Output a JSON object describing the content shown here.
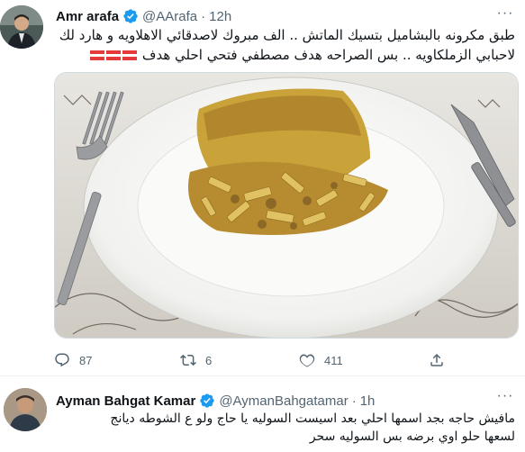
{
  "tweets": [
    {
      "author": {
        "name": "Amr arafa",
        "handle": "@AArafa",
        "time": "12h",
        "verified": true
      },
      "text_line1": "طبق مكرونه بالبشاميل بتسيك الماتش .. الف مبروك لاصدقائي الاهلاويه و هارد لك",
      "text_line2": "لاحبابي الزملكاويه .. بس الصراحه هدف مصطفي فتحي احلي هدف",
      "flags_count": 3,
      "photo_description_icon": "food-photo",
      "stats": {
        "replies": "87",
        "retweets": "6",
        "likes": "411"
      }
    },
    {
      "author": {
        "name": "Ayman Bahgat Kamar",
        "handle": "@AymanBahgatamar",
        "time": "1h",
        "verified": true
      },
      "text_line1": "مافيش حاجه بجد اسمها احلي بعد اسيست السوليه يا حاج ولو ع الشوطه ديانج",
      "text_line2": "لسعها حلو اوي برضه بس السوليه سحر"
    }
  ],
  "colors": {
    "verified": "#1d9bf0",
    "muted": "#536471",
    "flag_red": "#e53a3a"
  }
}
